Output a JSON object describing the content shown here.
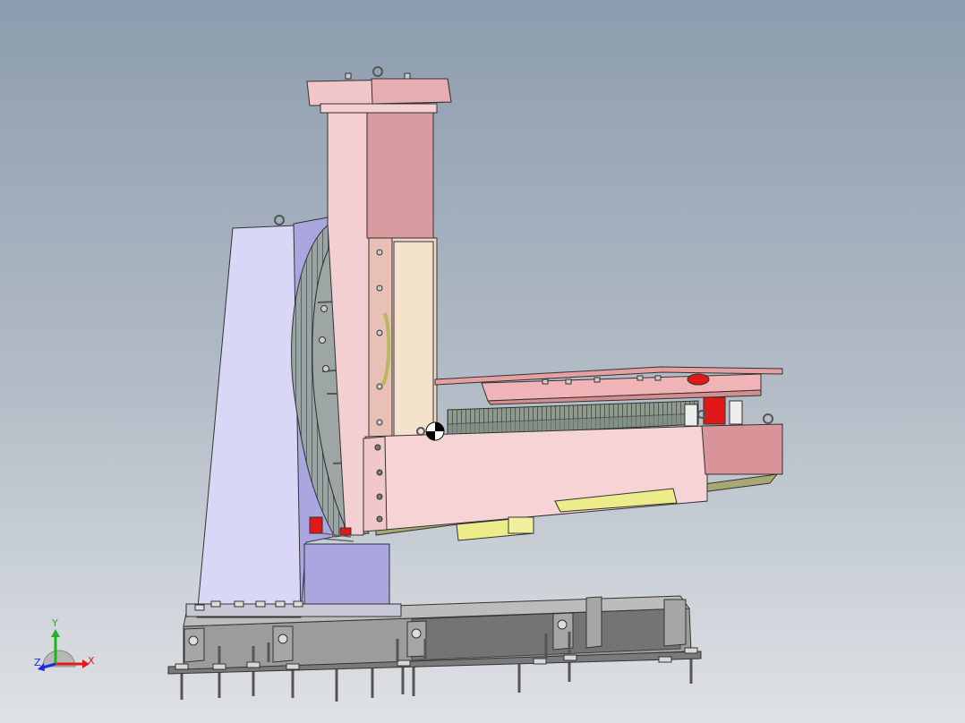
{
  "viewport": {
    "background_top": "#8c9cae",
    "background_bottom": "#dfe2e6"
  },
  "triad": {
    "x_label": "X",
    "y_label": "Y",
    "z_label": "Z",
    "x_color": "#e11a1a",
    "y_color": "#1eb41e",
    "z_color": "#1a2ee1"
  },
  "model": {
    "colors": {
      "column_pink": "#f3cfd1",
      "column_dark_pink": "#d99aa0",
      "pedestal_lavender": "#d8d8f6",
      "pedestal_purple": "#a9a6e0",
      "gear_gray": "#8e9a98",
      "base_gray": "#8f8f8f",
      "pad_yellow": "#ecec8a",
      "red_part": "#e01818",
      "arm_pink": "#f6d4d6",
      "table_salmon": "#eaa4a4"
    }
  }
}
